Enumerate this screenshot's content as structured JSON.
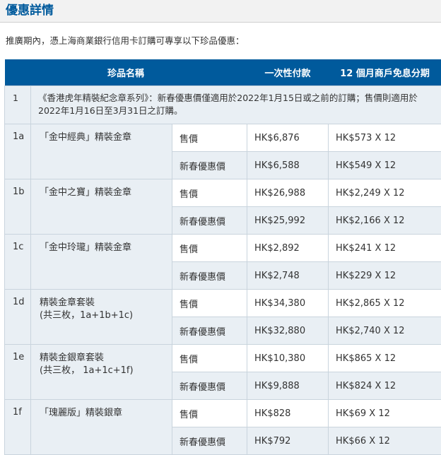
{
  "page": {
    "title": "優惠詳情",
    "intro": "推廣期內，憑上海商業銀行信用卡訂購可專享以下珍品優惠："
  },
  "table": {
    "headers": {
      "item": "珍品名稱",
      "one_time": "一次性付款",
      "installment": "12 個月商戶免息分期"
    },
    "note": {
      "number": "1",
      "text": "《香港虎年精裝紀念章系列》：新春優惠價僅適用於2022年1月15日或之前的訂購；售價則適用於2022年1月16日至3月31日之訂購。"
    },
    "rows": [
      {
        "number": "1a",
        "name": "「金中經典」精裝金章",
        "name2": "",
        "sale_label": "售價",
        "sale_price": "HK$6,876",
        "sale_inst": "HK$573 X 12",
        "promo_label": "新春優惠價",
        "promo_price": "HK$6,588",
        "promo_inst": "HK$549 X 12"
      },
      {
        "number": "1b",
        "name": "「金中之寶」精裝金章",
        "name2": "",
        "sale_label": "售價",
        "sale_price": "HK$26,988",
        "sale_inst": "HK$2,249 X 12",
        "promo_label": "新春優惠價",
        "promo_price": "HK$25,992",
        "promo_inst": "HK$2,166 X 12"
      },
      {
        "number": "1c",
        "name": "「金中玲瓏」精裝金章",
        "name2": "",
        "sale_label": "售價",
        "sale_price": "HK$2,892",
        "sale_inst": "HK$241 X 12",
        "promo_label": "新春優惠價",
        "promo_price": "HK$2,748",
        "promo_inst": "HK$229 X 12"
      },
      {
        "number": "1d",
        "name": "精裝金章套裝",
        "name2": "(共三枚，1a+1b+1c)",
        "sale_label": "售價",
        "sale_price": "HK$34,380",
        "sale_inst": "HK$2,865 X 12",
        "promo_label": "新春優惠價",
        "promo_price": "HK$32,880",
        "promo_inst": "HK$2,740 X 12"
      },
      {
        "number": "1e",
        "name": "精裝金銀章套裝",
        "name2": "(共三枚， 1a+1c+1f)",
        "sale_label": "售價",
        "sale_price": "HK$10,380",
        "sale_inst": "HK$865 X 12",
        "promo_label": "新春優惠價",
        "promo_price": "HK$9,888",
        "promo_inst": "HK$824 X 12"
      },
      {
        "number": "1f",
        "name": "「瑰麗版」精裝銀章",
        "name2": "",
        "sale_label": "售價",
        "sale_price": "HK$828",
        "sale_inst": "HK$69 X 12",
        "promo_label": "新春優惠價",
        "promo_price": "HK$792",
        "promo_inst": "HK$66 X 12"
      }
    ]
  }
}
